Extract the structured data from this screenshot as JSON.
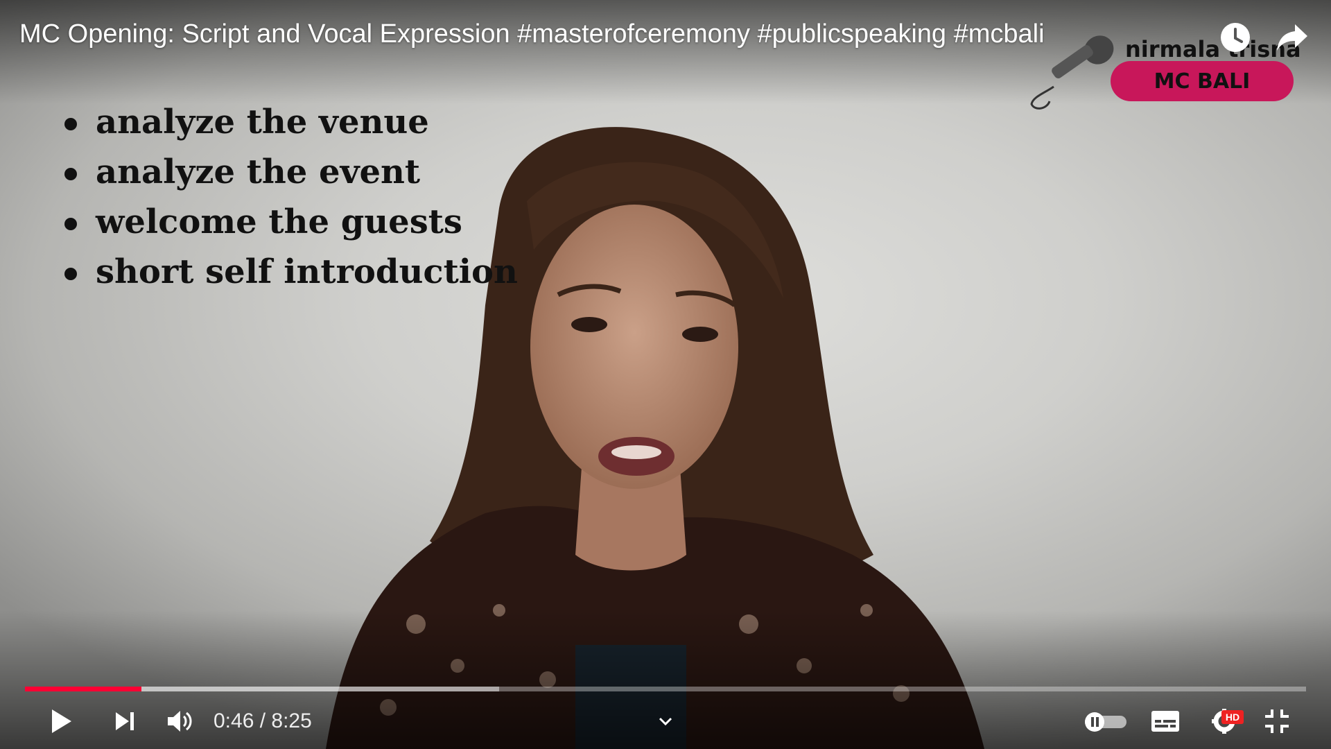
{
  "video": {
    "title": "MC Opening: Script and Vocal Expression #masterofceremony #publicspeaking #mcbali"
  },
  "slide": {
    "bullets": [
      "analyze the venue",
      "analyze the event",
      "welcome the guests",
      "short self introduction"
    ]
  },
  "brand": {
    "name": "nirmala trisna",
    "badge": "MC BALI",
    "badge_color": "#c8175a"
  },
  "top_actions": [
    {
      "name": "watch-later",
      "icon": "clock-icon"
    },
    {
      "name": "share",
      "icon": "share-arrow-icon"
    }
  ],
  "player": {
    "current_time": "0:46",
    "duration": "8:25",
    "time_display": "0:46 / 8:25",
    "progress_fraction": 0.091,
    "buffered_fraction": 0.37,
    "accent_color": "#ff0033",
    "quality_badge": "HD",
    "autoplay": "off",
    "controls": [
      {
        "name": "play",
        "icon": "play-icon"
      },
      {
        "name": "next",
        "icon": "next-icon"
      },
      {
        "name": "volume",
        "icon": "volume-icon"
      },
      {
        "name": "chapters",
        "icon": "chevron-down-icon"
      },
      {
        "name": "autoplay",
        "icon": "autoplay-toggle-icon"
      },
      {
        "name": "subtitles",
        "icon": "subtitles-icon"
      },
      {
        "name": "settings",
        "icon": "gear-icon"
      },
      {
        "name": "exit-fullscreen",
        "icon": "exit-fullscreen-icon"
      }
    ]
  }
}
